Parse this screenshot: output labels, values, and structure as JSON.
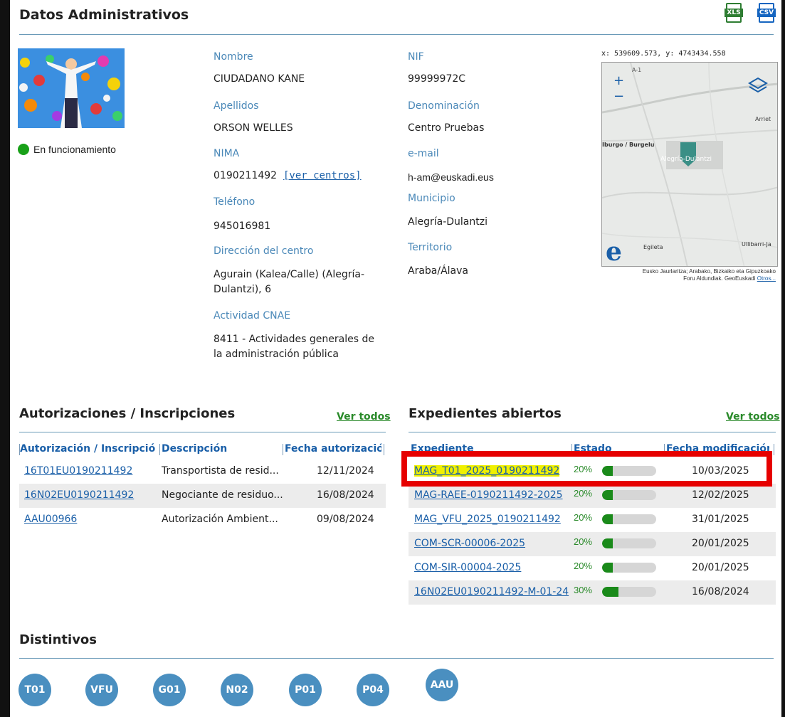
{
  "header": {
    "title": "Datos Administrativos",
    "xls_label": "XLS",
    "csv_label": "CSV"
  },
  "status": {
    "label": "En funcionamiento",
    "color": "#18a018"
  },
  "fields": {
    "nombre": {
      "label": "Nombre",
      "value": "CIUDADANO KANE"
    },
    "apellidos": {
      "label": "Apellidos",
      "value": "ORSON WELLES"
    },
    "nima": {
      "label": "NIMA",
      "value": "0190211492",
      "link": "[ver centros]"
    },
    "telefono": {
      "label": "Teléfono",
      "value": "945016981"
    },
    "direccion": {
      "label": "Dirección del centro",
      "value_line1": "Agurain (Kalea/Calle) (Alegría-",
      "value_line2": "Dulantzi), 6"
    },
    "cnae": {
      "label": "Actividad CNAE",
      "value_line1": "8411 - Actividades generales de",
      "value_line2": "la administración pública"
    },
    "nif": {
      "label": "NIF",
      "value": "99999972C"
    },
    "denominacion": {
      "label": "Denominación",
      "value": "Centro Pruebas"
    },
    "email": {
      "label": "e-mail",
      "value": "h-am@euskadi.eus"
    },
    "municipio": {
      "label": "Municipio",
      "value": "Alegría-Dulantzi"
    },
    "territorio": {
      "label": "Territorio",
      "value": "Araba/Álava"
    }
  },
  "map": {
    "coords": "x: 539609.573, y: 4743434.558",
    "labels": {
      "road": "A-1",
      "arrieta": "Arriet",
      "burgelu": "Iburgo / Burgelu",
      "alegria": "Alegría-Dulantzi",
      "egileta": "Egileta",
      "ullibarri": "Ullibarri-Ja"
    },
    "zoom_in": "+",
    "zoom_out": "−",
    "credit_line1": "Eusko Jaurlaritza; Arabako, Bizkaiko eta Gipuzkoako",
    "credit_line2": "Foru Aldundiak. GeoEuskadi",
    "credit_link": "Otros..."
  },
  "autorizaciones": {
    "title": "Autorizaciones / Inscripciones",
    "ver_todos": "Ver todos",
    "headers": [
      "Autorización / Inscripción",
      "Descripción",
      "Fecha autorización"
    ],
    "rows": [
      {
        "code": "16T01EU0190211492",
        "desc": "Transportista de resid...",
        "date": "12/11/2024"
      },
      {
        "code": "16N02EU0190211492",
        "desc": "Negociante de residuo...",
        "date": "16/08/2024"
      },
      {
        "code": "AAU00966",
        "desc": "Autorización Ambient...",
        "date": "09/08/2024"
      }
    ]
  },
  "expedientes": {
    "title": "Expedientes abiertos",
    "ver_todos": "Ver todos",
    "headers": [
      "Expediente",
      "Estado",
      "Fecha modificación"
    ],
    "rows": [
      {
        "code": "MAG_T01_2025_0190211492",
        "pct": "20%",
        "progress": 0.2,
        "date": "10/03/2025"
      },
      {
        "code": "MAG-RAEE-0190211492-2025",
        "pct": "20%",
        "progress": 0.2,
        "date": "12/02/2025"
      },
      {
        "code": "MAG_VFU_2025_0190211492",
        "pct": "20%",
        "progress": 0.2,
        "date": "31/01/2025"
      },
      {
        "code": "COM-SCR-00006-2025",
        "pct": "20%",
        "progress": 0.2,
        "date": "20/01/2025"
      },
      {
        "code": "COM-SIR-00004-2025",
        "pct": "20%",
        "progress": 0.2,
        "date": "20/01/2025"
      },
      {
        "code": "16N02EU0190211492-M-01-24",
        "pct": "30%",
        "progress": 0.3,
        "date": "16/08/2024"
      }
    ]
  },
  "distintivos": {
    "title": "Distintivos",
    "badges": [
      "T01",
      "VFU",
      "G01",
      "N02",
      "P01",
      "P04",
      "AAU"
    ]
  },
  "colors": {
    "accent": "#4a88b8",
    "link": "#1a5fa8",
    "green": "#2a8a2a",
    "badge": "#4a8fc0",
    "highlight": "#e60000"
  }
}
